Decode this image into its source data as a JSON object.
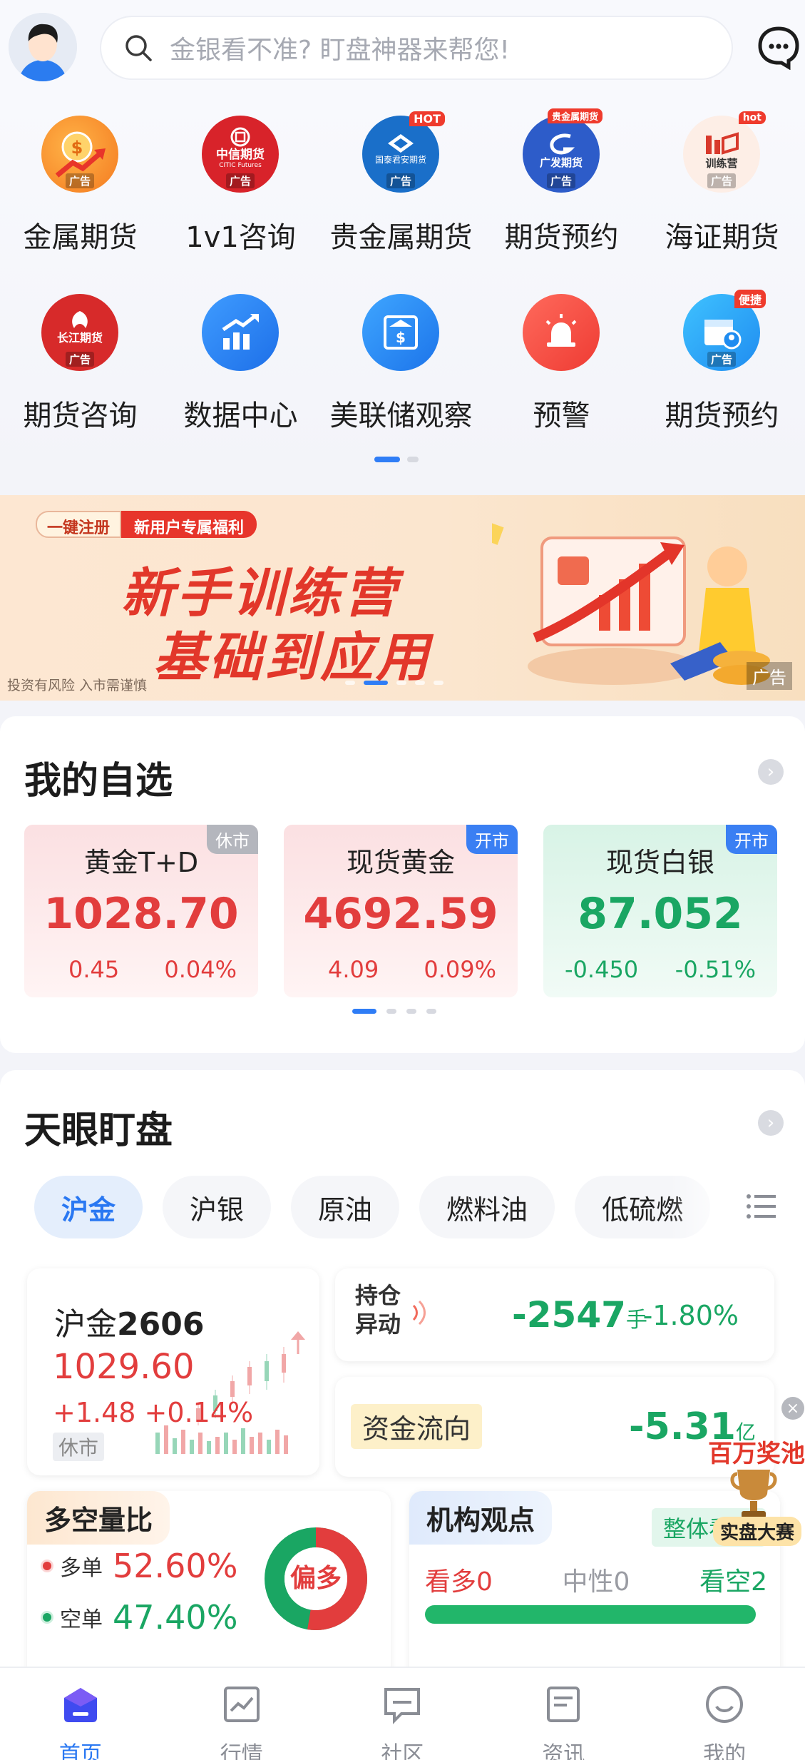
{
  "header": {
    "search_placeholder": "金银看不准? 盯盘神器来帮您!"
  },
  "icon_grid": {
    "row1": [
      {
        "label": "金属期货",
        "icon": "gold-coin-chart-icon",
        "ad": "广告"
      },
      {
        "label": "1v1咨询",
        "icon": "citic-futures-logo",
        "ad": "广告"
      },
      {
        "label": "贵金属期货",
        "icon": "guotai-junan-futures-logo",
        "ad": "广告",
        "tag": "HOT"
      },
      {
        "label": "期货预约",
        "icon": "gf-futures-logo",
        "ad": "广告",
        "tag": "贵金属期货"
      },
      {
        "label": "海证期货",
        "icon": "training-camp-icon",
        "ad": "广告",
        "tag": "hot"
      }
    ],
    "row2": [
      {
        "label": "期货咨询",
        "icon": "changjiang-futures-logo",
        "ad": "广告"
      },
      {
        "label": "数据中心",
        "icon": "bar-chart-up-icon"
      },
      {
        "label": "美联储观察",
        "icon": "bank-building-icon"
      },
      {
        "label": "预警",
        "icon": "alarm-siren-icon"
      },
      {
        "label": "期货预约",
        "icon": "calendar-user-icon",
        "ad": "广告",
        "tag": "便捷"
      }
    ],
    "logo_texts": {
      "citic": "中信期货",
      "citic_en": "CITIC Futures",
      "gtja": "国泰君安期货",
      "gf": "广发期货",
      "camp": "训练营",
      "cj": "长江期货"
    }
  },
  "banner": {
    "pill_left": "一键注册",
    "pill_right": "新用户专属福利",
    "title_line1": "新手训练营",
    "title_line2": "基础到应用",
    "risk_note": "投资有风险 入市需谨慎",
    "ad_label": "广告"
  },
  "watchlist": {
    "title": "我的自选",
    "quotes": [
      {
        "name": "黄金T+D",
        "price": "1028.70",
        "change": "0.45",
        "pct": "0.04%",
        "status": "休市",
        "trend": "up"
      },
      {
        "name": "现货黄金",
        "price": "4692.59",
        "change": "4.09",
        "pct": "0.09%",
        "status": "开市",
        "trend": "up"
      },
      {
        "name": "现货白银",
        "price": "87.052",
        "change": "-0.450",
        "pct": "-0.51%",
        "status": "开市",
        "trend": "down"
      }
    ]
  },
  "sky_eye": {
    "title": "天眼盯盘",
    "tabs": [
      "沪金",
      "沪银",
      "原油",
      "燃料油",
      "低硫燃"
    ],
    "active_tab": 0,
    "contract": {
      "prefix": "沪金",
      "code": "2606",
      "price": "1029.60",
      "change": "+1.48",
      "pct": "+0.14%",
      "status": "休市"
    },
    "position_change": {
      "label_line1": "持仓",
      "label_line2": "异动",
      "value": "-2547",
      "unit": "手",
      "pct": "-1.80%"
    },
    "fund_flow": {
      "label": "资金流向",
      "value": "-5.31",
      "unit": "亿"
    },
    "long_short": {
      "title": "多空量比",
      "long_label": "多单",
      "long_value": "52.60%",
      "short_label": "空单",
      "short_value": "47.40%",
      "long_fraction": 0.526,
      "verdict": "偏多"
    },
    "institution": {
      "title": "机构观点",
      "overall": "整体看空",
      "bull": "看多0",
      "neutral": "中性0",
      "bear": "看空2"
    }
  },
  "promo": {
    "line1": "百万奖池",
    "line2": "实盘大赛"
  },
  "bottom_nav": [
    {
      "label": "首页",
      "icon": "home-cap-icon",
      "active": true
    },
    {
      "label": "行情",
      "icon": "market-chart-icon",
      "active": false
    },
    {
      "label": "社区",
      "icon": "community-chat-icon",
      "active": false
    },
    {
      "label": "资讯",
      "icon": "news-doc-icon",
      "active": false
    },
    {
      "label": "我的",
      "icon": "profile-smile-icon",
      "active": false
    }
  ],
  "colors": {
    "up": "#e23d3d",
    "down": "#1aa663",
    "accent": "#2a78f2"
  }
}
